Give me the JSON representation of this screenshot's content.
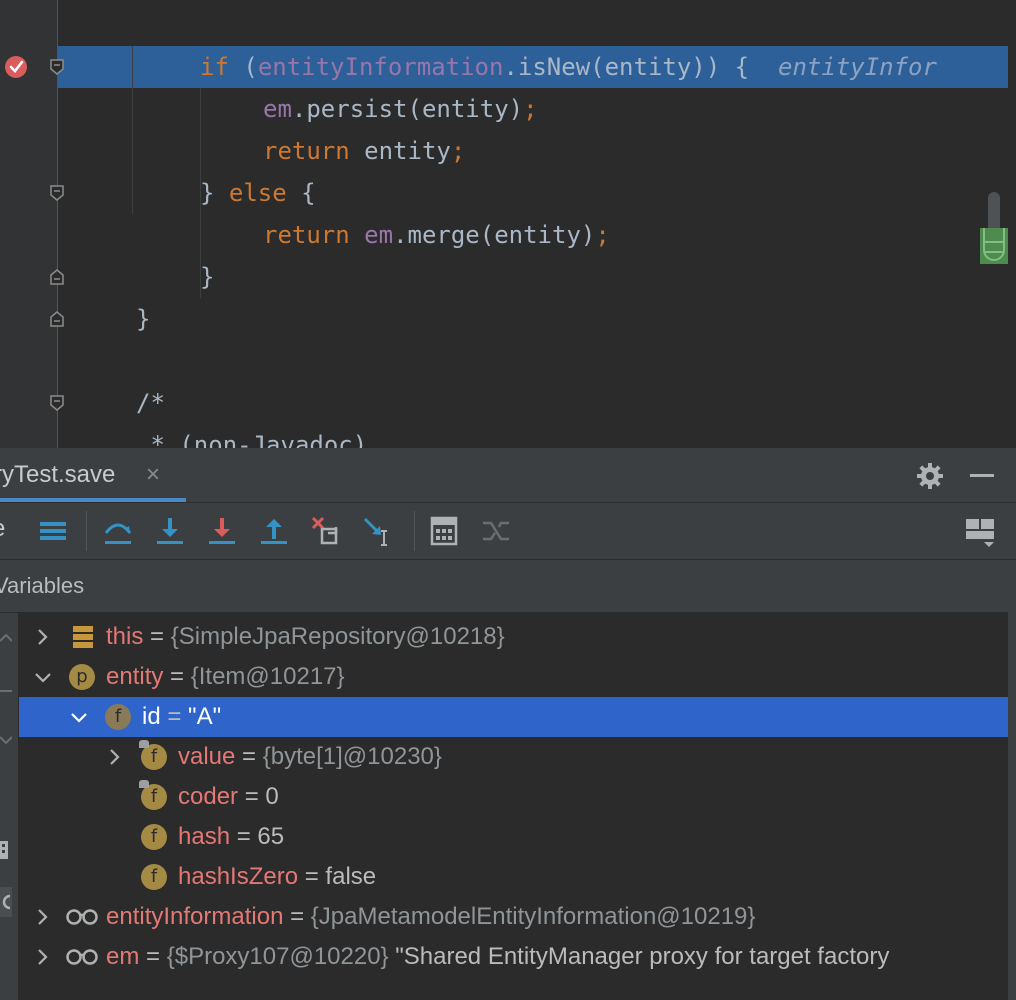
{
  "editor": {
    "lines": [
      {
        "segments": [
          [
            "kw",
            "if "
          ],
          [
            "plain",
            "("
          ],
          [
            "field",
            "entityInformation"
          ],
          [
            "plain",
            ".isNew(entity)) {  "
          ],
          [
            "hint",
            "entityInfor"
          ]
        ]
      },
      {
        "segments": [
          [
            "field",
            "em"
          ],
          [
            "plain",
            ".persist(entity)"
          ],
          [
            "kw",
            ";"
          ]
        ]
      },
      {
        "segments": [
          [
            "kw",
            "return "
          ],
          [
            "plain",
            "entity"
          ],
          [
            "kw",
            ";"
          ]
        ]
      },
      {
        "segments": [
          [
            "plain",
            "} "
          ],
          [
            "kw",
            "else "
          ],
          [
            "plain",
            "{"
          ]
        ]
      },
      {
        "segments": [
          [
            "kw",
            "return "
          ],
          [
            "field",
            "em"
          ],
          [
            "plain",
            ".merge(entity)"
          ],
          [
            "kw",
            ";"
          ]
        ]
      },
      {
        "segments": [
          [
            "plain",
            "}"
          ]
        ]
      },
      {
        "segments": [
          [
            "plain",
            "}"
          ]
        ]
      },
      {
        "segments": [
          [
            "plain",
            "/*"
          ]
        ]
      },
      {
        "segments": [
          [
            "plain",
            " * (non-Javadoc)"
          ]
        ]
      }
    ]
  },
  "debug": {
    "tab_label": "ryTest.save",
    "tab_close": "×",
    "toolbar_cut_label": "e",
    "variables_title": "Variables"
  },
  "variables": [
    {
      "name": "this",
      "eq": " = ",
      "value": "{SimpleJpaRepository@10218}",
      "icon": "stack-icon",
      "expandable": true,
      "expanded": false
    },
    {
      "name": "entity",
      "eq": " = ",
      "value": "{Item@10217}",
      "icon": "p",
      "expandable": true,
      "expanded": true
    },
    {
      "name": "id",
      "eq": " = ",
      "value": "\"A\"",
      "icon": "f",
      "expandable": true,
      "expanded": true,
      "selected": true
    },
    {
      "name": "value",
      "eq": " = ",
      "value": "{byte[1]@10230}",
      "icon": "f",
      "lock": true,
      "expandable": true,
      "expanded": false
    },
    {
      "name": "coder",
      "eq": " = ",
      "value": "0",
      "icon": "f",
      "lock": true,
      "expandable": false
    },
    {
      "name": "hash",
      "eq": " = ",
      "value": "65",
      "icon": "f",
      "expandable": false
    },
    {
      "name": "hashIsZero",
      "eq": " = ",
      "value": "false",
      "icon": "f",
      "expandable": false
    },
    {
      "name": "entityInformation",
      "eq": " = ",
      "value": "{JpaMetamodelEntityInformation@10219}",
      "icon": "watch-icon",
      "expandable": true,
      "expanded": false
    },
    {
      "name": "em",
      "eq": " = ",
      "value": "{$Proxy107@10220}",
      "extra": " \"Shared EntityManager proxy for target factory",
      "icon": "watch-icon",
      "expandable": true,
      "expanded": false
    }
  ],
  "colors": {
    "exec_line": "#2d6099",
    "selected_row": "#2f65ca",
    "keyword": "#cc7832",
    "field": "#9876aa",
    "var_name": "#e47875"
  }
}
